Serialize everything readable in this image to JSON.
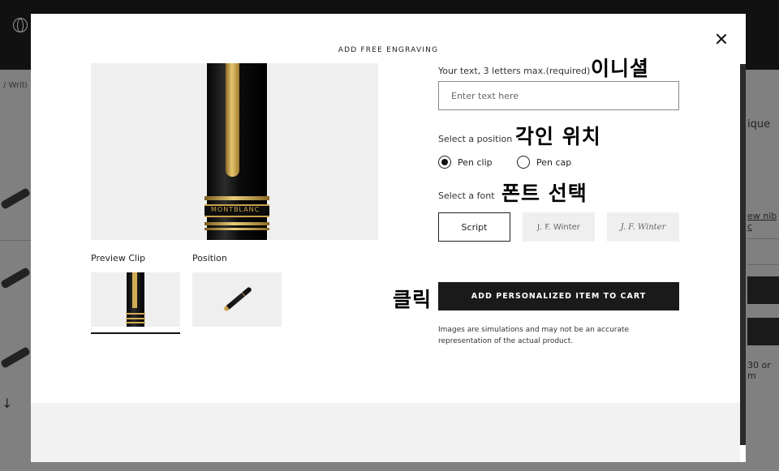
{
  "background": {
    "breadcrumb": "/ Writi",
    "right_title": "ique",
    "right_link": "ew nib c",
    "right_small": "30 or m",
    "arrow": "↓"
  },
  "modal": {
    "title": "ADD FREE ENGRAVING",
    "preview_engraving": "MONTBLANC",
    "thumbnails": [
      {
        "label": "Preview Clip"
      },
      {
        "label": "Position"
      }
    ],
    "text_field": {
      "label": "Your text, 3 letters max.(required)",
      "placeholder": "Enter text here",
      "value": ""
    },
    "position": {
      "label": "Select a position",
      "options": [
        {
          "label": "Pen clip",
          "checked": true
        },
        {
          "label": "Pen cap",
          "checked": false
        }
      ]
    },
    "font": {
      "label": "Select a font",
      "options": [
        "Script",
        "J. F. Winter",
        "J. F. Winter"
      ],
      "selected": "Script"
    },
    "cart_button": "ADD PERSONALIZED ITEM TO CART",
    "disclaimer": "Images are simulations and may not be an accurate representation of the actual product."
  },
  "annotations": {
    "initials": "이니셜",
    "position": "각인 위치",
    "font": "폰트 선택",
    "click": "클릭"
  },
  "colors": {
    "button_bg": "#1a1a1a",
    "pen_gold": "#c9a24d",
    "option_bg": "#efefef"
  }
}
